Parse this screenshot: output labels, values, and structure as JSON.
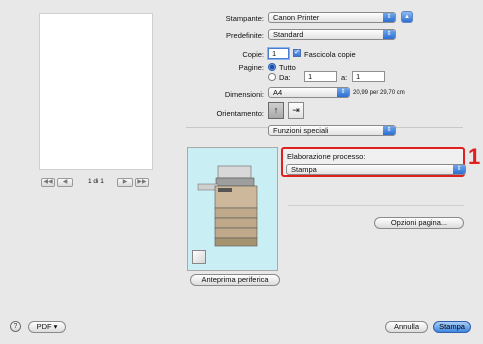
{
  "printer": {
    "label": "Stampante:",
    "value": "Canon Printer"
  },
  "presets": {
    "label": "Predefinite:",
    "value": "Standard"
  },
  "copies": {
    "label": "Copie:",
    "value": "1",
    "collate_label": "Fascicola copie",
    "collate_checked": true
  },
  "pages": {
    "label": "Pagine:",
    "all_label": "Tutto",
    "from_label": "Da:",
    "from_value": "1",
    "to_label": "a:",
    "to_value": "1"
  },
  "paper_size": {
    "label": "Dimensioni:",
    "value": "A4",
    "info": "20,99 per 29,70 cm"
  },
  "orientation": {
    "label": "Orientamento:"
  },
  "section_popup": {
    "value": "Funzioni speciali"
  },
  "processing": {
    "label": "Elaborazione processo:",
    "value": "Stampa"
  },
  "callout_number": "1",
  "page_options_button": "Opzioni pagina...",
  "preview": {
    "page_indicator": "1 di 1"
  },
  "device_preview_button": "Anteprima periferica",
  "bottom": {
    "help": "?",
    "pdf_button": "PDF ▾",
    "cancel_button": "Annulla",
    "print_button": "Stampa"
  }
}
